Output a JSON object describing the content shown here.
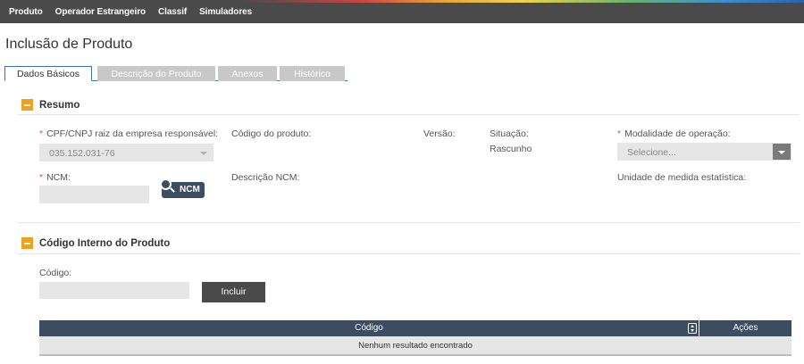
{
  "topbar": {
    "menu": [
      "Produto",
      "Operador Estrangeiro",
      "Classif",
      "Simuladores"
    ]
  },
  "page": {
    "title": "Inclusão de Produto"
  },
  "tabs": [
    {
      "label": "Dados Básicos",
      "active": true
    },
    {
      "label": "Descrição do Produto",
      "active": false
    },
    {
      "label": "Anexos",
      "active": false
    },
    {
      "label": "Histórico",
      "active": false
    }
  ],
  "resumo": {
    "title": "Resumo",
    "cnpj_label": "CPF/CNPJ raiz da empresa responsável:",
    "cnpj_value": "035.152.031-76",
    "codigo_produto_label": "Código do produto:",
    "versao_label": "Versão:",
    "situacao_label": "Situação:",
    "situacao_value": "Rascunho",
    "modalidade_label": "Modalidade de operação:",
    "modalidade_placeholder": "Selecione...",
    "ncm_label": "NCM:",
    "ncm_button": "NCM",
    "descricao_ncm_label": "Descrição NCM:",
    "unidade_label": "Unidade de medida estatística:",
    "required_mark": "*"
  },
  "codigo_interno": {
    "title": "Código Interno do Produto",
    "codigo_label": "Código:",
    "incluir_button": "Incluir",
    "table": {
      "columns": [
        "Código",
        "Ações"
      ],
      "empty_message": "Nenhum resultado encontrado"
    }
  },
  "colors": {
    "topbar": "#4a4a4a",
    "accent_toggle": "#f0a020",
    "table_header": "#3c4d63",
    "tab_border": "#3a74b0",
    "required": "#e05050"
  }
}
